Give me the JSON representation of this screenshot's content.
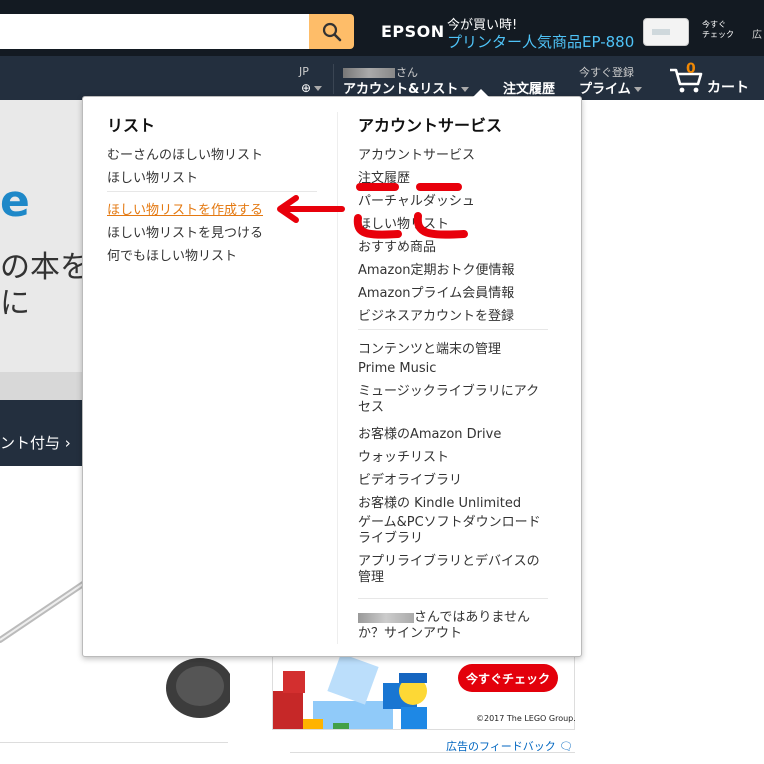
{
  "header": {
    "ad": {
      "brand": "EPSON",
      "line1": "今が買い時!",
      "line2": "プリンター人気商品EP-880",
      "check_small": "今すぐ\nチェック",
      "corner": "広"
    }
  },
  "nav": {
    "language": "JP",
    "account_greeting_suffix": "さん",
    "account_label": "アカウント&リスト",
    "orders_label": "注文履歴",
    "prime_small": "今すぐ登録",
    "prime_label": "プライム",
    "cart_count": "0",
    "cart_label": "カート"
  },
  "background": {
    "hero_letter": "e",
    "hero_line1": "の本を",
    "hero_line2": "に",
    "strip_text": "ント付与 ›"
  },
  "flyout": {
    "lists": {
      "heading": "リスト",
      "group1": [
        "むーさんのほしい物リスト",
        "ほしい物リスト"
      ],
      "group2": [
        "ほしい物リストを作成する",
        "ほしい物リストを見つける",
        "何でもほしい物リスト"
      ]
    },
    "account": {
      "heading": "アカウントサービス",
      "group1": [
        "アカウントサービス",
        "注文履歴",
        "パーチャルダッシュ",
        "ほしい物リスト",
        "おすすめ商品",
        "Amazon定期おトク便情報",
        "Amazonプライム会員情報",
        "ビジネスアカウントを登録"
      ],
      "group2": [
        "コンテンツと端末の管理",
        "Prime Music",
        "ミュージックライブラリにアクセス",
        "お客様のAmazon Drive",
        "ウォッチリスト",
        "ビデオライブラリ",
        "お客様の Kindle Unlimited",
        "ゲーム&PCソフトダウンロードライブラリ",
        "アプリライブラリとデバイスの管理"
      ],
      "signout": "さんではありませんか？サインアウト"
    }
  },
  "lego_ad": {
    "button": "今すぐチェック",
    "copyright": "©2017 The LEGO Group.",
    "feedback": "広告のフィードバック"
  }
}
